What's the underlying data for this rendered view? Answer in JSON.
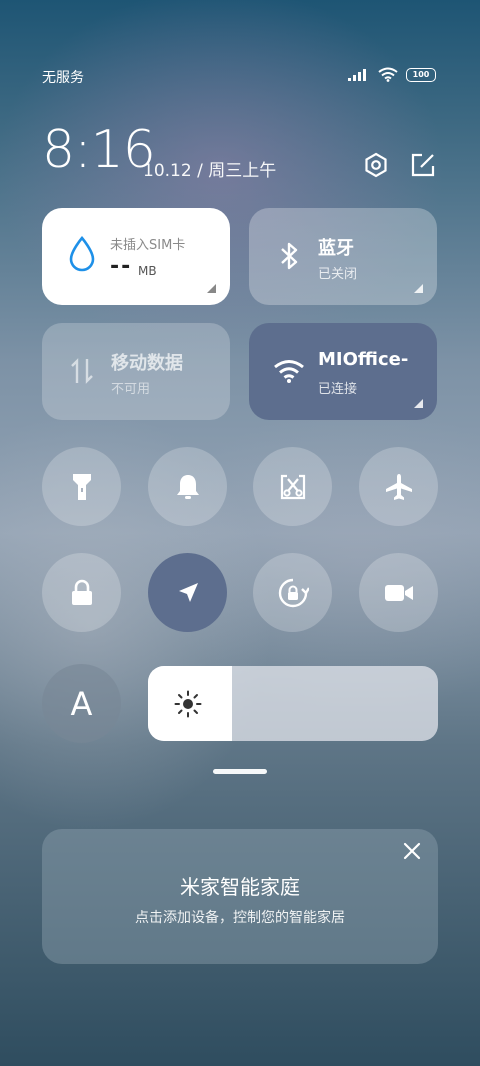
{
  "status_bar": {
    "carrier": "无服务",
    "battery": "100"
  },
  "header": {
    "time": "8:16",
    "date": "10.12 / 周三上午"
  },
  "tiles": {
    "data_usage": {
      "label": "未插入SIM卡",
      "value": "--",
      "unit": "MB"
    },
    "bluetooth": {
      "title": "蓝牙",
      "status": "已关闭"
    },
    "mobile_data": {
      "title": "移动数据",
      "status": "不可用"
    },
    "wifi": {
      "title": "MIOffice-",
      "status": "已连接"
    }
  },
  "toggles": {
    "row1": [
      "flashlight-icon",
      "bell-icon",
      "screenshot-icon",
      "airplane-icon"
    ],
    "row2": [
      "lock-icon",
      "location-icon",
      "rotation-lock-icon",
      "video-camera-icon"
    ],
    "active": [
      "location-icon",
      "wifi-tile"
    ]
  },
  "reading_mode": {
    "label": "A"
  },
  "brightness": {
    "level": 0.29
  },
  "colors": {
    "tile_white": "#ffffff",
    "tile_active": "#5d6e8e",
    "accent_blue": "#1e90e8"
  },
  "mijia_card": {
    "title": "米家智能家庭",
    "subtitle": "点击添加设备，控制您的智能家居"
  }
}
